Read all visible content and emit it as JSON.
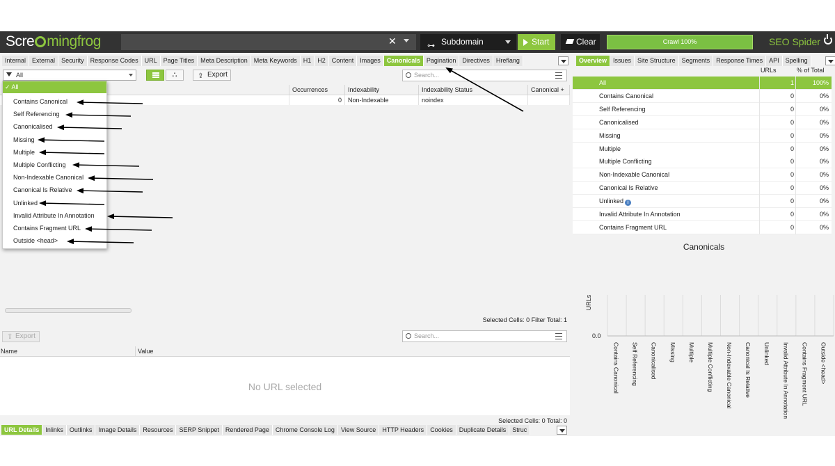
{
  "header": {
    "logo_text_left": "Scre",
    "logo_text_right": "mingfrog",
    "mode_label": "Subdomain",
    "start_label": "Start",
    "clear_label": "Clear",
    "progress_label": "Crawl 100%",
    "progress_value": 100,
    "brand_label": "SEO Spider"
  },
  "left_tabs": [
    "Internal",
    "External",
    "Security",
    "Response Codes",
    "URL",
    "Page Titles",
    "Meta Description",
    "Meta Keywords",
    "H1",
    "H2",
    "Content",
    "Images",
    "Canonicals",
    "Pagination",
    "Directives",
    "Hreflang"
  ],
  "left_active_tab": "Canonicals",
  "right_tabs": [
    "Overview",
    "Issues",
    "Site Structure",
    "Segments",
    "Response Times",
    "API",
    "Spelling"
  ],
  "right_active_tab": "Overview",
  "toolbar": {
    "filter_value": "All",
    "export_label": "Export",
    "search_placeholder": "Search..."
  },
  "main_table": {
    "columns": [
      "Occurrences",
      "Indexability",
      "Indexability Status",
      "Canonical"
    ],
    "row": {
      "occurrences": "0",
      "indexability": "Non-Indexable",
      "indexability_status": "noindex"
    },
    "status": "Selected Cells:  0  Filter Total:  1"
  },
  "filter_dropdown": {
    "selected": "✓ All",
    "items": [
      "Contains Canonical",
      "Self Referencing",
      "Canonicalised",
      "Missing",
      "Multiple",
      "Multiple Conflicting",
      "Non-Indexable Canonical",
      "Canonical Is Relative",
      "Unlinked",
      "Invalid Attribute In Annotation",
      "Contains Fragment URL",
      "Outside <head>"
    ]
  },
  "bottom_panel": {
    "export_label": "Export",
    "search_placeholder": "Search...",
    "col_name": "Name",
    "col_value": "Value",
    "empty_message": "No URL selected",
    "status": "Selected Cells:  0  Total:  0"
  },
  "overview": {
    "col_urls": "URLs",
    "col_pct": "% of Total",
    "rows": [
      {
        "label": "All",
        "urls": "1",
        "pct": "100%"
      },
      {
        "label": "Contains Canonical",
        "urls": "0",
        "pct": "0%"
      },
      {
        "label": "Self Referencing",
        "urls": "0",
        "pct": "0%"
      },
      {
        "label": "Canonicalised",
        "urls": "0",
        "pct": "0%"
      },
      {
        "label": "Missing",
        "urls": "0",
        "pct": "0%"
      },
      {
        "label": "Multiple",
        "urls": "0",
        "pct": "0%"
      },
      {
        "label": "Multiple Conflicting",
        "urls": "0",
        "pct": "0%"
      },
      {
        "label": "Non-Indexable Canonical",
        "urls": "0",
        "pct": "0%"
      },
      {
        "label": "Canonical Is Relative",
        "urls": "0",
        "pct": "0%"
      },
      {
        "label": "Unlinked",
        "urls": "0",
        "pct": "0%"
      },
      {
        "label": "Invalid Attribute In Annotation",
        "urls": "0",
        "pct": "0%"
      },
      {
        "label": "Contains Fragment URL",
        "urls": "0",
        "pct": "0%"
      }
    ]
  },
  "chart_data": {
    "type": "bar",
    "title": "Canonicals",
    "ylabel": "URLs",
    "xlabel": "",
    "ytick": "0.0",
    "categories": [
      "Contains Canonical",
      "Self Referencing",
      "Canonicalised",
      "Missing",
      "Multiple",
      "Multiple Conflicting",
      "Non-Indexable Canonical",
      "Canonical Is Relative",
      "Unlinked",
      "Invalid Attribute In Annotation",
      "Contains Fragment URL",
      "Outside <head>"
    ],
    "values": [
      0,
      0,
      0,
      0,
      0,
      0,
      0,
      0,
      0,
      0,
      0,
      0
    ]
  },
  "bottom_tabs": [
    "URL Details",
    "Inlinks",
    "Outlinks",
    "Image Details",
    "Resources",
    "SERP Snippet",
    "Rendered Page",
    "Chrome Console Log",
    "View Source",
    "HTTP Headers",
    "Cookies",
    "Duplicate Details",
    "Struc"
  ],
  "bottom_active_tab": "URL Details",
  "colors": {
    "accent": "#8dc63f",
    "topbar": "#333333",
    "annotation": "#000000"
  }
}
